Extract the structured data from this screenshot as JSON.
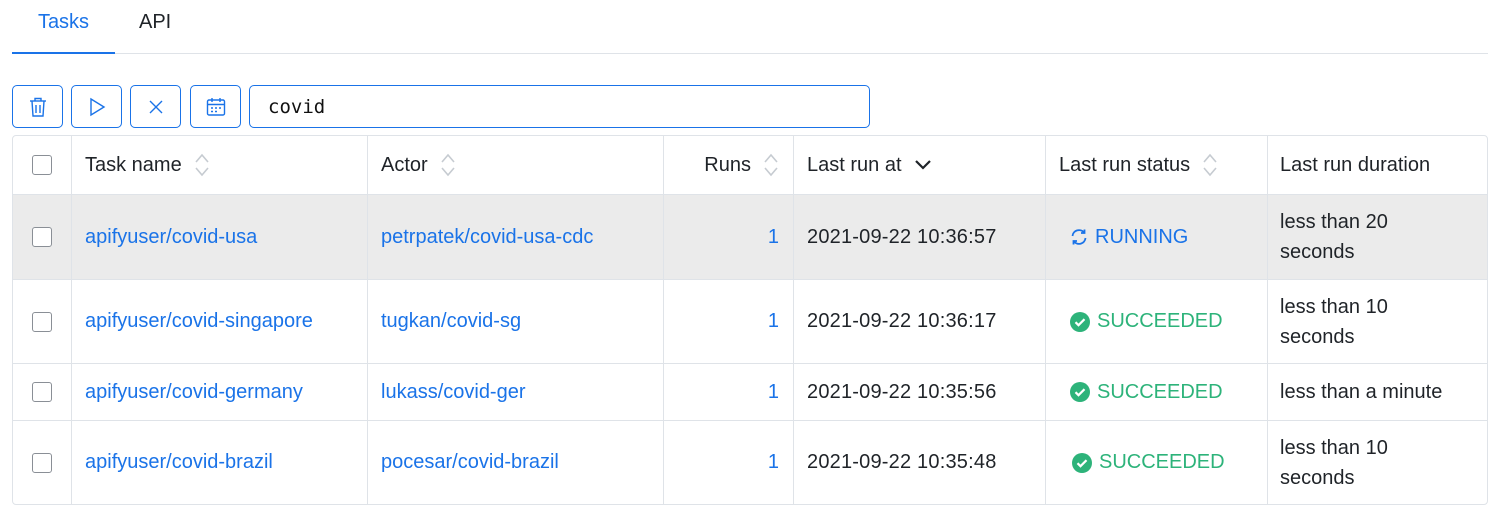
{
  "tabs": [
    {
      "label": "Tasks",
      "active": true
    },
    {
      "label": "API",
      "active": false
    }
  ],
  "toolbar": {
    "search_value": "covid",
    "buttons": [
      "trash-icon",
      "play-icon",
      "close-icon",
      "calendar-icon"
    ]
  },
  "table": {
    "headers": {
      "task_name": "Task name",
      "actor": "Actor",
      "runs": "Runs",
      "last_run_at": "Last run at",
      "last_run_status": "Last run status",
      "last_run_duration": "Last run duration"
    },
    "rows": [
      {
        "task": "apifyuser/covid-usa",
        "actor": "petrpatek/covid-usa-cdc",
        "runs": "1",
        "last_run_at": "2021-09-22 10:36:57",
        "status": "RUNNING",
        "duration": "less than 20 seconds"
      },
      {
        "task": "apifyuser/covid-singapore",
        "actor": "tugkan/covid-sg",
        "runs": "1",
        "last_run_at": "2021-09-22 10:36:17",
        "status": "SUCCEEDED",
        "duration": "less than 10 seconds"
      },
      {
        "task": "apifyuser/covid-germany",
        "actor": "lukass/covid-ger",
        "runs": "1",
        "last_run_at": "2021-09-22 10:35:56",
        "status": "SUCCEEDED",
        "duration": "less than a minute"
      },
      {
        "task": "apifyuser/covid-brazil",
        "actor": "pocesar/covid-brazil",
        "runs": "1",
        "last_run_at": "2021-09-22 10:35:48",
        "status": "SUCCEEDED",
        "duration": "less than 10 seconds"
      }
    ]
  },
  "colors": {
    "accent": "#1a73e8",
    "success": "#2db37a",
    "highlight_row": "#ebebeb",
    "border": "#dfe3e8"
  }
}
